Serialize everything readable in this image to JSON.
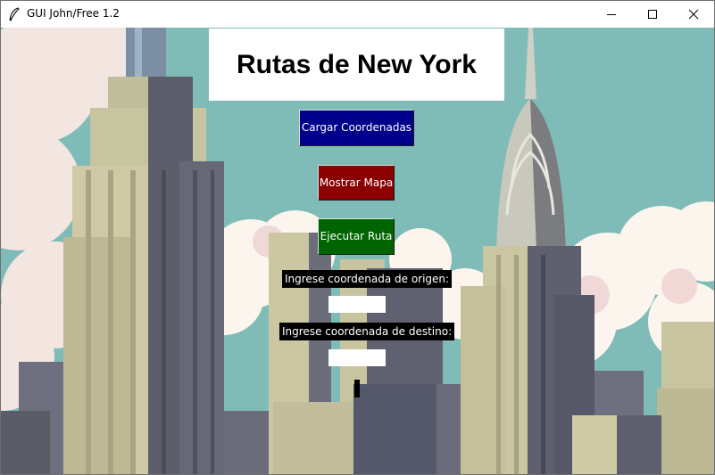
{
  "window": {
    "title": "GUI John/Free 1.2",
    "icon": "feather-icon",
    "controls": [
      "minimize-icon",
      "maximize-icon",
      "close-icon"
    ]
  },
  "header": {
    "title": "Rutas de New York"
  },
  "buttons": {
    "load": "Cargar Coordenadas",
    "map": "Mostrar Mapa",
    "run": "Ejecutar Ruta"
  },
  "form": {
    "origin_label": "Ingrese coordenada de origen:",
    "origin_value": "",
    "dest_label": "Ingrese coordenada de destino:",
    "dest_value": "",
    "result": ""
  },
  "colors": {
    "sky": "#7fbcb8",
    "load_button": "#00008b",
    "map_button": "#8b0000",
    "run_button": "#006400"
  }
}
